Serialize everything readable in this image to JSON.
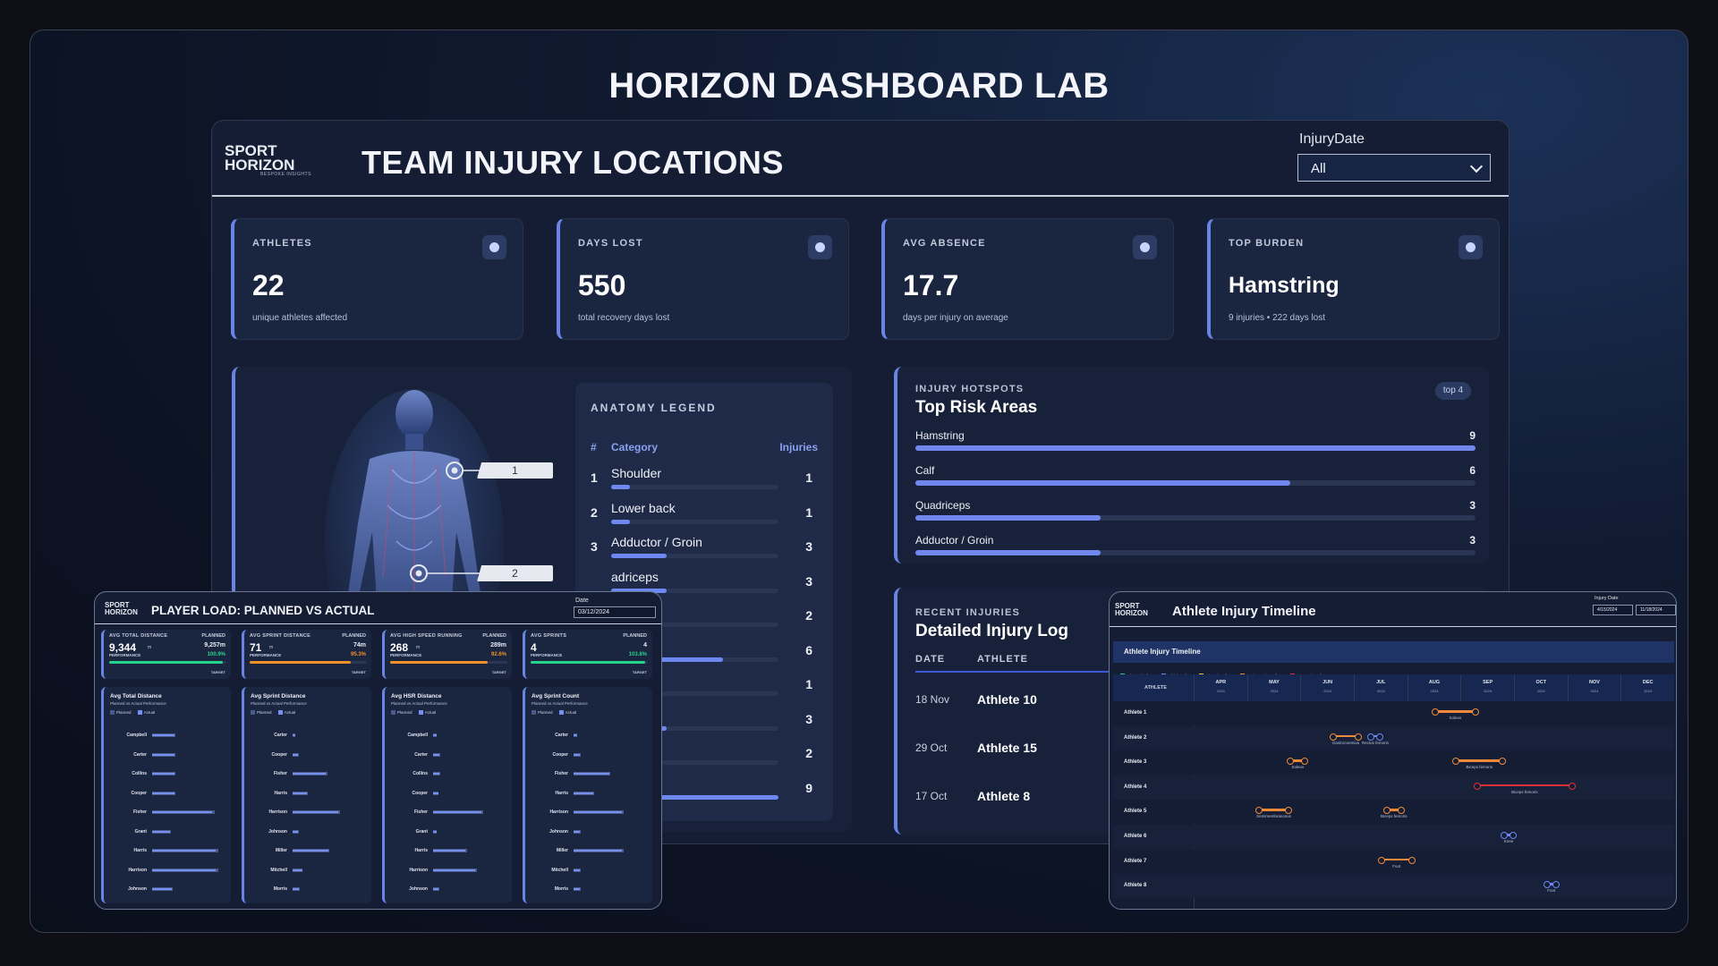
{
  "page_title": "HORIZON DASHBOARD LAB",
  "logo": {
    "line1": "SPORT",
    "line2": "HORIZON",
    "tagline": "BESPOKE INSIGHTS"
  },
  "main": {
    "title": "TEAM INJURY LOCATIONS",
    "filter": {
      "label": "InjuryDate",
      "value": "All"
    },
    "kpis": [
      {
        "label": "ATHLETES",
        "value": "22",
        "sub": "unique athletes affected"
      },
      {
        "label": "DAYS LOST",
        "value": "550",
        "sub": "total recovery days lost"
      },
      {
        "label": "AVG ABSENCE",
        "value": "17.7",
        "sub": "days per injury on average"
      },
      {
        "label": "TOP BURDEN",
        "value": "Hamstring",
        "sub": "9 injuries • 222 days lost"
      }
    ],
    "callouts": [
      "1",
      "2"
    ],
    "legend": {
      "title": "ANATOMY LEGEND",
      "col_num": "#",
      "col_cat": "Category",
      "col_inj": "Injuries",
      "rows": [
        {
          "n": "1",
          "cat": "Shoulder",
          "v": "1",
          "f": 0.11
        },
        {
          "n": "2",
          "cat": "Lower back",
          "v": "1",
          "f": 0.11
        },
        {
          "n": "3",
          "cat": "Adductor / Groin",
          "v": "3",
          "f": 0.33
        },
        {
          "n": "",
          "cat": "adriceps",
          "v": "3",
          "f": 0.33
        },
        {
          "n": "",
          "cat": "e",
          "v": "2",
          "f": 0.22
        },
        {
          "n": "",
          "cat": "",
          "v": "6",
          "f": 0.67
        },
        {
          "n": "",
          "cat": "de",
          "v": "1",
          "f": 0.11
        },
        {
          "n": "",
          "cat": "/ Achilles",
          "v": "3",
          "f": 0.33
        },
        {
          "n": "",
          "cat": "t",
          "v": "2",
          "f": 0.22
        },
        {
          "n": "",
          "cat": "nstring",
          "v": "9",
          "f": 1.0
        }
      ]
    },
    "hotspots": {
      "eyebrow": "INJURY HOTSPOTS",
      "title": "Top Risk Areas",
      "pill": "top 4",
      "rows": [
        {
          "cat": "Hamstring",
          "v": "9",
          "f": 1.0
        },
        {
          "cat": "Calf",
          "v": "6",
          "f": 0.67
        },
        {
          "cat": "Quadriceps",
          "v": "3",
          "f": 0.33
        },
        {
          "cat": "Adductor / Groin",
          "v": "3",
          "f": 0.33
        }
      ]
    },
    "log": {
      "eyebrow": "RECENT INJURIES",
      "title": "Detailed Injury Log",
      "col_date": "DATE",
      "col_athlete": "ATHLETE",
      "rows": [
        {
          "date": "18 Nov",
          "athlete": "Athlete 10"
        },
        {
          "date": "29 Oct",
          "athlete": "Athlete 15"
        },
        {
          "date": "17 Oct",
          "athlete": "Athlete 8"
        }
      ]
    }
  },
  "load": {
    "title": "PLAYER LOAD: PLANNED VS ACTUAL",
    "date_label": "Date",
    "date_value": "03/12/2024",
    "kpis": [
      {
        "label": "AVG TOTAL DISTANCE",
        "value": "9,344",
        "unit": "m",
        "planned": "9,257m",
        "pct": "100.9%",
        "color": "#27d38a",
        "f": 0.97
      },
      {
        "label": "AVG SPRINT DISTANCE",
        "value": "71",
        "unit": "m",
        "planned": "74m",
        "pct": "95.3%",
        "color": "#f0902a",
        "f": 0.86
      },
      {
        "label": "AVG HIGH SPEED RUNNING",
        "value": "268",
        "unit": "m",
        "planned": "289m",
        "pct": "92.6%",
        "color": "#f0902a",
        "f": 0.83
      },
      {
        "label": "AVG SPRINTS",
        "value": "4",
        "unit": "",
        "planned": "4",
        "pct": "103.8%",
        "color": "#27d38a",
        "f": 0.98
      }
    ],
    "planned_label": "PLANNED",
    "perf_label": "PERFORMANCE",
    "target_label": "TARGET",
    "charts": [
      {
        "title": "Avg Total Distance",
        "sub": "Planned vs Actual Performance",
        "names": [
          "Campbell",
          "Carter",
          "Collins",
          "Cooper",
          "Fisher",
          "Grant",
          "Harris",
          "Harrison",
          "Johnson"
        ],
        "values": [
          0.35,
          0.35,
          0.35,
          0.35,
          0.93,
          0.28,
          0.98,
          0.98,
          0.31
        ]
      },
      {
        "title": "Avg Sprint Distance",
        "sub": "Planned vs Actual Performance",
        "names": [
          "Carter",
          "Cooper",
          "Fisher",
          "Harris",
          "Harrison",
          "Johnson",
          "Miller",
          "Mitchell",
          "Morris"
        ],
        "values": [
          0.04,
          0.09,
          0.52,
          0.22,
          0.71,
          0.09,
          0.55,
          0.15,
          0.1
        ]
      },
      {
        "title": "Avg HSR Distance",
        "sub": "Planned vs Actual Performance",
        "names": [
          "Campbell",
          "Carter",
          "Collins",
          "Cooper",
          "Fisher",
          "Grant",
          "Harris",
          "Harrison",
          "Johnson"
        ],
        "values": [
          0.05,
          0.1,
          0.1,
          0.08,
          0.75,
          0.05,
          0.5,
          0.65,
          0.09
        ]
      },
      {
        "title": "Avg Sprint Count",
        "sub": "Planned vs Actual Performance",
        "names": [
          "Carter",
          "Cooper",
          "Fisher",
          "Harris",
          "Harrison",
          "Johnson",
          "Miller",
          "Mitchell",
          "Morris"
        ],
        "values": [
          0.05,
          0.1,
          0.55,
          0.3,
          0.75,
          0.1,
          0.75,
          0.1,
          0.1
        ]
      }
    ],
    "legend_planned": "Planned",
    "legend_actual": "Actual"
  },
  "timeline": {
    "title": "Athlete Injury Timeline",
    "subtitle": "Athlete Injury Timeline",
    "date_label": "Injury Date",
    "date_from": "4/15/2024",
    "date_to": "11/18/2024",
    "legend": [
      {
        "name": "Minimal (0d)",
        "color": "#27d38a"
      },
      {
        "name": "Mild (1-3d)",
        "color": "#6d88f0"
      },
      {
        "name": "Minor (4-7d)",
        "color": "#f0c23a"
      },
      {
        "name": "Moderate (8-28d)",
        "color": "#f08a3a"
      },
      {
        "name": "Severe (>28d)",
        "color": "#e0303a"
      }
    ],
    "col_athlete": "ATHLETE",
    "months": [
      "APR",
      "MAY",
      "JUN",
      "JUL",
      "AUG",
      "SEP",
      "OCT",
      "NOV",
      "DEC"
    ],
    "year": "2024",
    "rows": [
      {
        "name": "Athlete 1",
        "segs": [
          {
            "s": 4.5,
            "e": 5.3,
            "c": "#f08a3a",
            "l": "Soleus"
          }
        ]
      },
      {
        "name": "Athlete 2",
        "segs": [
          {
            "s": 2.6,
            "e": 3.1,
            "c": "#f08a3a",
            "l": "Gastrocnemius"
          },
          {
            "s": 3.3,
            "e": 3.5,
            "c": "#6d88f0",
            "l": "Rectus femoris"
          }
        ]
      },
      {
        "name": "Athlete 3",
        "segs": [
          {
            "s": 1.8,
            "e": 2.1,
            "c": "#f08a3a",
            "l": "Soleus"
          },
          {
            "s": 4.9,
            "e": 5.8,
            "c": "#f08a3a",
            "l": "Biceps femoris"
          }
        ]
      },
      {
        "name": "Athlete 4",
        "segs": [
          {
            "s": 5.3,
            "e": 7.1,
            "c": "#e0303a",
            "l": "Biceps femoris"
          }
        ]
      },
      {
        "name": "Athlete 5",
        "segs": [
          {
            "s": 1.2,
            "e": 1.8,
            "c": "#f08a3a",
            "l": "Semimembranosus"
          },
          {
            "s": 3.6,
            "e": 3.9,
            "c": "#f08a3a",
            "l": "Biceps femoris"
          }
        ]
      },
      {
        "name": "Athlete 6",
        "segs": [
          {
            "s": 5.8,
            "e": 6.0,
            "c": "#6d88f0",
            "l": "Knee"
          }
        ]
      },
      {
        "name": "Athlete 7",
        "segs": [
          {
            "s": 3.5,
            "e": 4.1,
            "c": "#f08a3a",
            "l": "Foot"
          }
        ]
      },
      {
        "name": "Athlete 8",
        "segs": [
          {
            "s": 6.6,
            "e": 6.8,
            "c": "#6d88f0",
            "l": "Foot"
          }
        ]
      }
    ]
  }
}
